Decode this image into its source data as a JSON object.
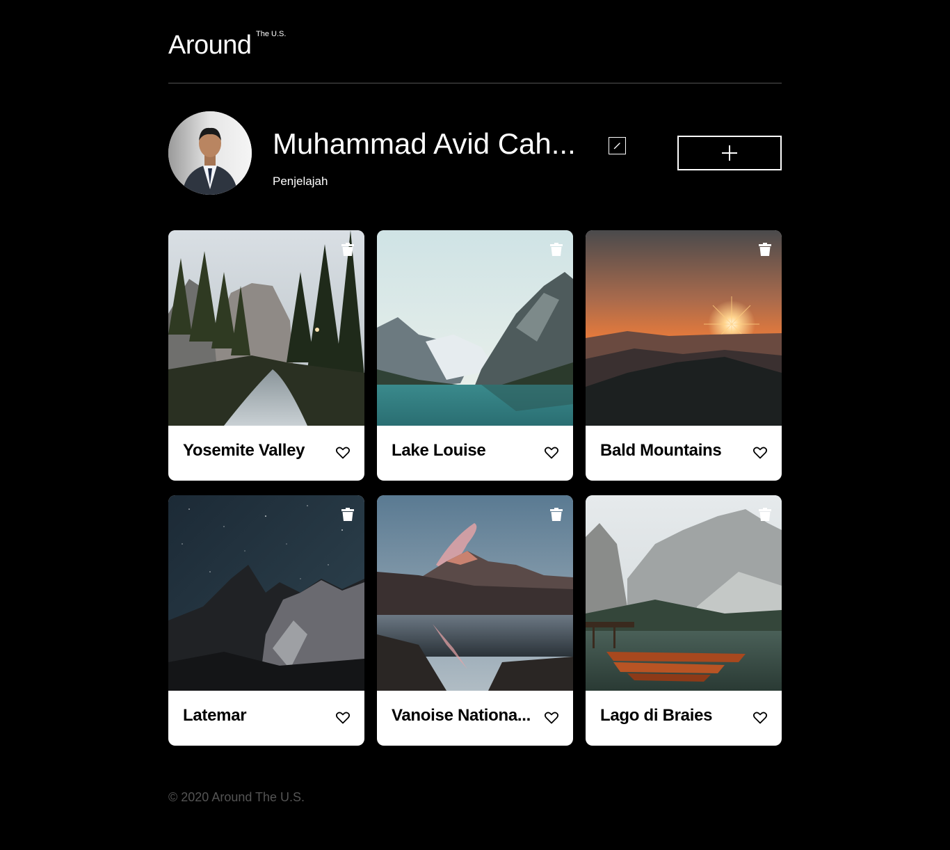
{
  "header": {
    "logo": "Around",
    "logo_superscript": "The U.S."
  },
  "profile": {
    "name": "Muhammad Avid Cah...",
    "about": "Penjelajah"
  },
  "cards": [
    {
      "title": "Yosemite Valley"
    },
    {
      "title": "Lake Louise"
    },
    {
      "title": "Bald Mountains"
    },
    {
      "title": "Latemar"
    },
    {
      "title": "Vanoise Nationa..."
    },
    {
      "title": "Lago di Braies"
    }
  ],
  "footer": {
    "text": "© 2020 Around The U.S."
  },
  "colors": {
    "background": "#000000",
    "card": "#ffffff",
    "footer_text": "#545454",
    "divider": "#545454"
  },
  "icons": {
    "edit": "pencil-icon",
    "add": "plus-icon",
    "delete": "trash-icon",
    "like": "heart-icon"
  }
}
